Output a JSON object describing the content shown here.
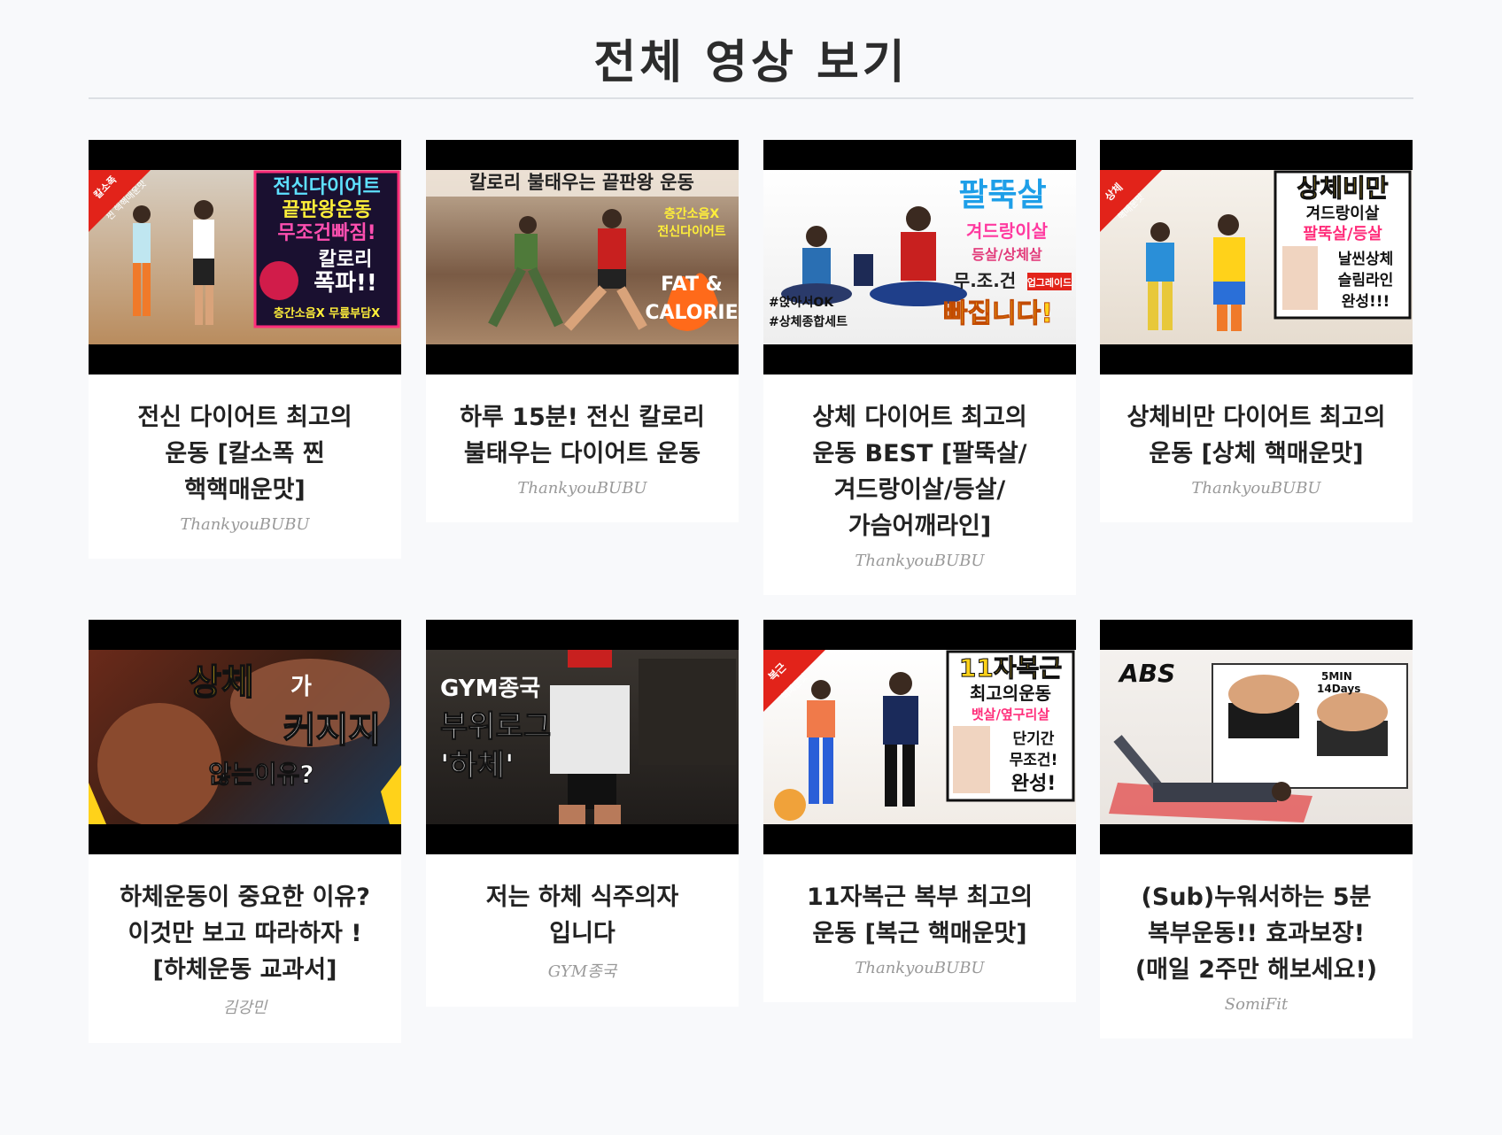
{
  "page": {
    "title": "전체 영상 보기"
  },
  "videos": [
    {
      "title": "전신 다이어트 최고의 운동 [칼소폭 찐 핵핵매운맛]",
      "channel": "ThankyouBUBU",
      "thumb_text": [
        "전신다이어트",
        "끝판왕운동",
        "무조건빠짐!",
        "칼로리",
        "폭파!!",
        "층간소음X 무릎부담X",
        "칼소폭",
        "찐 핵핵매운맛"
      ]
    },
    {
      "title": "하루 15분! 전신 칼로리 불태우는 다이어트 운동",
      "channel": "ThankyouBUBU",
      "thumb_text": [
        "칼로리 불태우는 끝판왕 운동",
        "층간소음X",
        "전신다이어트",
        "FAT &",
        "CALORIE"
      ]
    },
    {
      "title": "상체 다이어트 최고의 운동 BEST [팔뚝살/겨드랑이살/등살/가슴어깨라인]",
      "channel": "ThankyouBUBU",
      "thumb_text": [
        "팔뚝살",
        "겨드랑이살",
        "등살/상체살",
        "무.조.건",
        "업그레이드",
        "빠집니다!",
        "#앉아서OK",
        "#상체종합세트"
      ]
    },
    {
      "title": "상체비만 다이어트 최고의 운동 [상체 핵매운맛]",
      "channel": "ThankyouBUBU",
      "thumb_text": [
        "상체비만",
        "겨드랑이살",
        "팔뚝살/등살",
        "날씬상체",
        "슬림라인",
        "완성!!!",
        "상체",
        "핵매운맛"
      ]
    },
    {
      "title": "하체운동이 중요한 이유? 이것만 보고 따라하자 ! [하체운동 교과서]",
      "channel": "김강민",
      "thumb_text": [
        "상체",
        "가",
        "커지지",
        "않는이유?"
      ]
    },
    {
      "title": "저는 하체 식주의자 입니다",
      "channel": "GYM종국",
      "thumb_text": [
        "GYM종국",
        "부위로그",
        "'하체'"
      ]
    },
    {
      "title": "11자복근 복부 최고의 운동 [복근 핵매운맛]",
      "channel": "ThankyouBUBU",
      "thumb_text": [
        "11자복근",
        "최고의운동",
        "뱃살/옆구리살",
        "단기간",
        "무조건!",
        "완성!",
        "복근",
        "핵매운맛"
      ]
    },
    {
      "title": "(Sub)누워서하는 5분 복부운동!! 효과보장! (매일 2주만 해보세요!)",
      "channel": "SomiFit",
      "thumb_text": [
        "ABS",
        "5MIN",
        "14Days"
      ]
    }
  ],
  "colors": {
    "background": "#f8f9fb",
    "card": "#ffffff",
    "channel_text": "#999999",
    "divider": "#dcdfe4"
  }
}
